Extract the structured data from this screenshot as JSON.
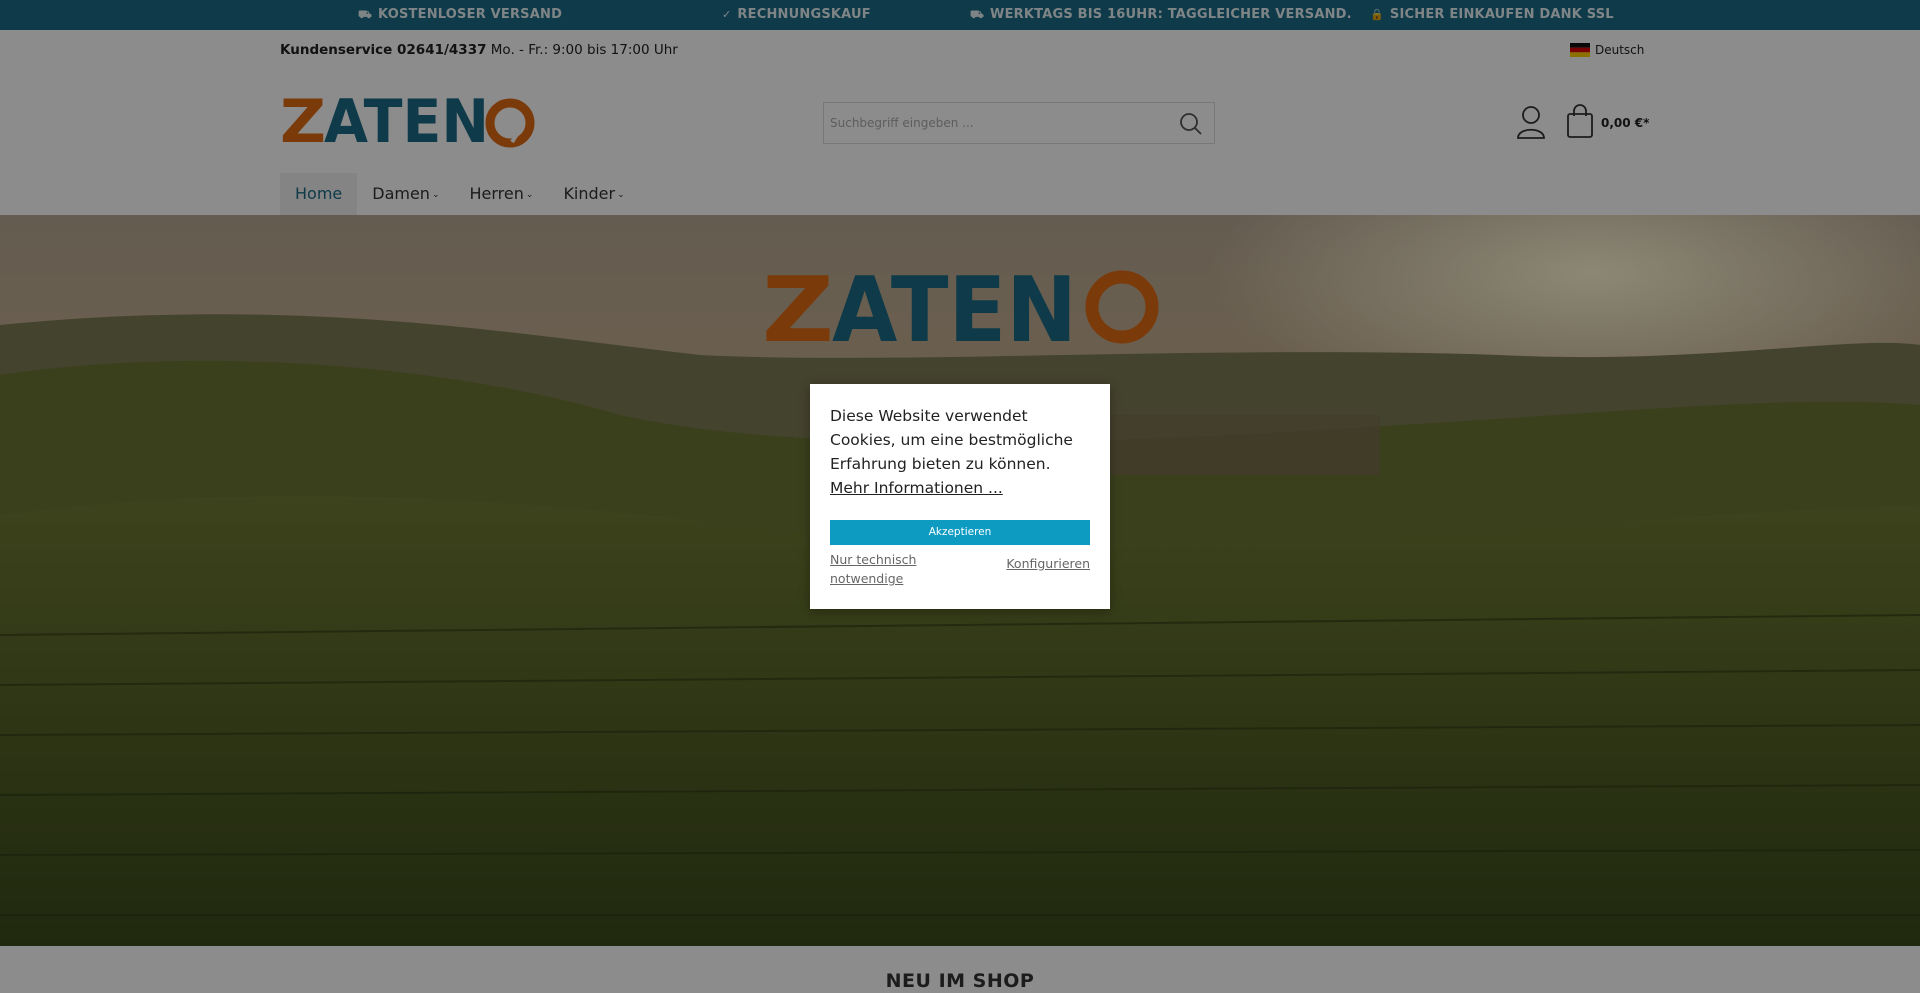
{
  "topbar": {
    "items": [
      {
        "icon": "truck-icon",
        "glyph": "⛟",
        "label": "KOSTENLOSER VERSAND"
      },
      {
        "icon": "check-icon",
        "glyph": "✓",
        "label": "RECHNUNGSKAUF"
      },
      {
        "icon": "truck-icon",
        "glyph": "⛟",
        "label": "WERKTAGS BIS 16UHR: TAGGLEICHER VERSAND."
      },
      {
        "icon": "lock-icon",
        "glyph": "🔒",
        "label": "SICHER EINKAUFEN DANK SSL"
      }
    ]
  },
  "header": {
    "service_label": "Kundenservice 02641/4337",
    "service_hours": "Mo. - Fr.: 9:00 bis 17:00 Uhr",
    "language": "Deutsch",
    "logo_text": "ZATENO",
    "search_placeholder": "Suchbegriff eingeben ...",
    "cart_amount": "0,00 €*"
  },
  "nav": {
    "items": [
      {
        "label": "Home",
        "active": true
      },
      {
        "label": "Damen",
        "active": false
      },
      {
        "label": "Herren",
        "active": false
      },
      {
        "label": "Kinder",
        "active": false
      }
    ]
  },
  "hero": {
    "logo_text": "ZATENO"
  },
  "section": {
    "title": "NEU IM SHOP"
  },
  "cookie": {
    "message": "Diese Website verwendet Cookies, um eine bestmögliche Erfahrung bieten zu können.",
    "more_info": "Mehr Informationen ...",
    "accept": "Akzeptieren",
    "necessary": "Nur technisch notwendige",
    "configure": "Konfigurieren"
  },
  "colors": {
    "brand_teal": "#1a6b85",
    "brand_orange": "#e06a12",
    "accept_button": "#0d9bc2"
  }
}
